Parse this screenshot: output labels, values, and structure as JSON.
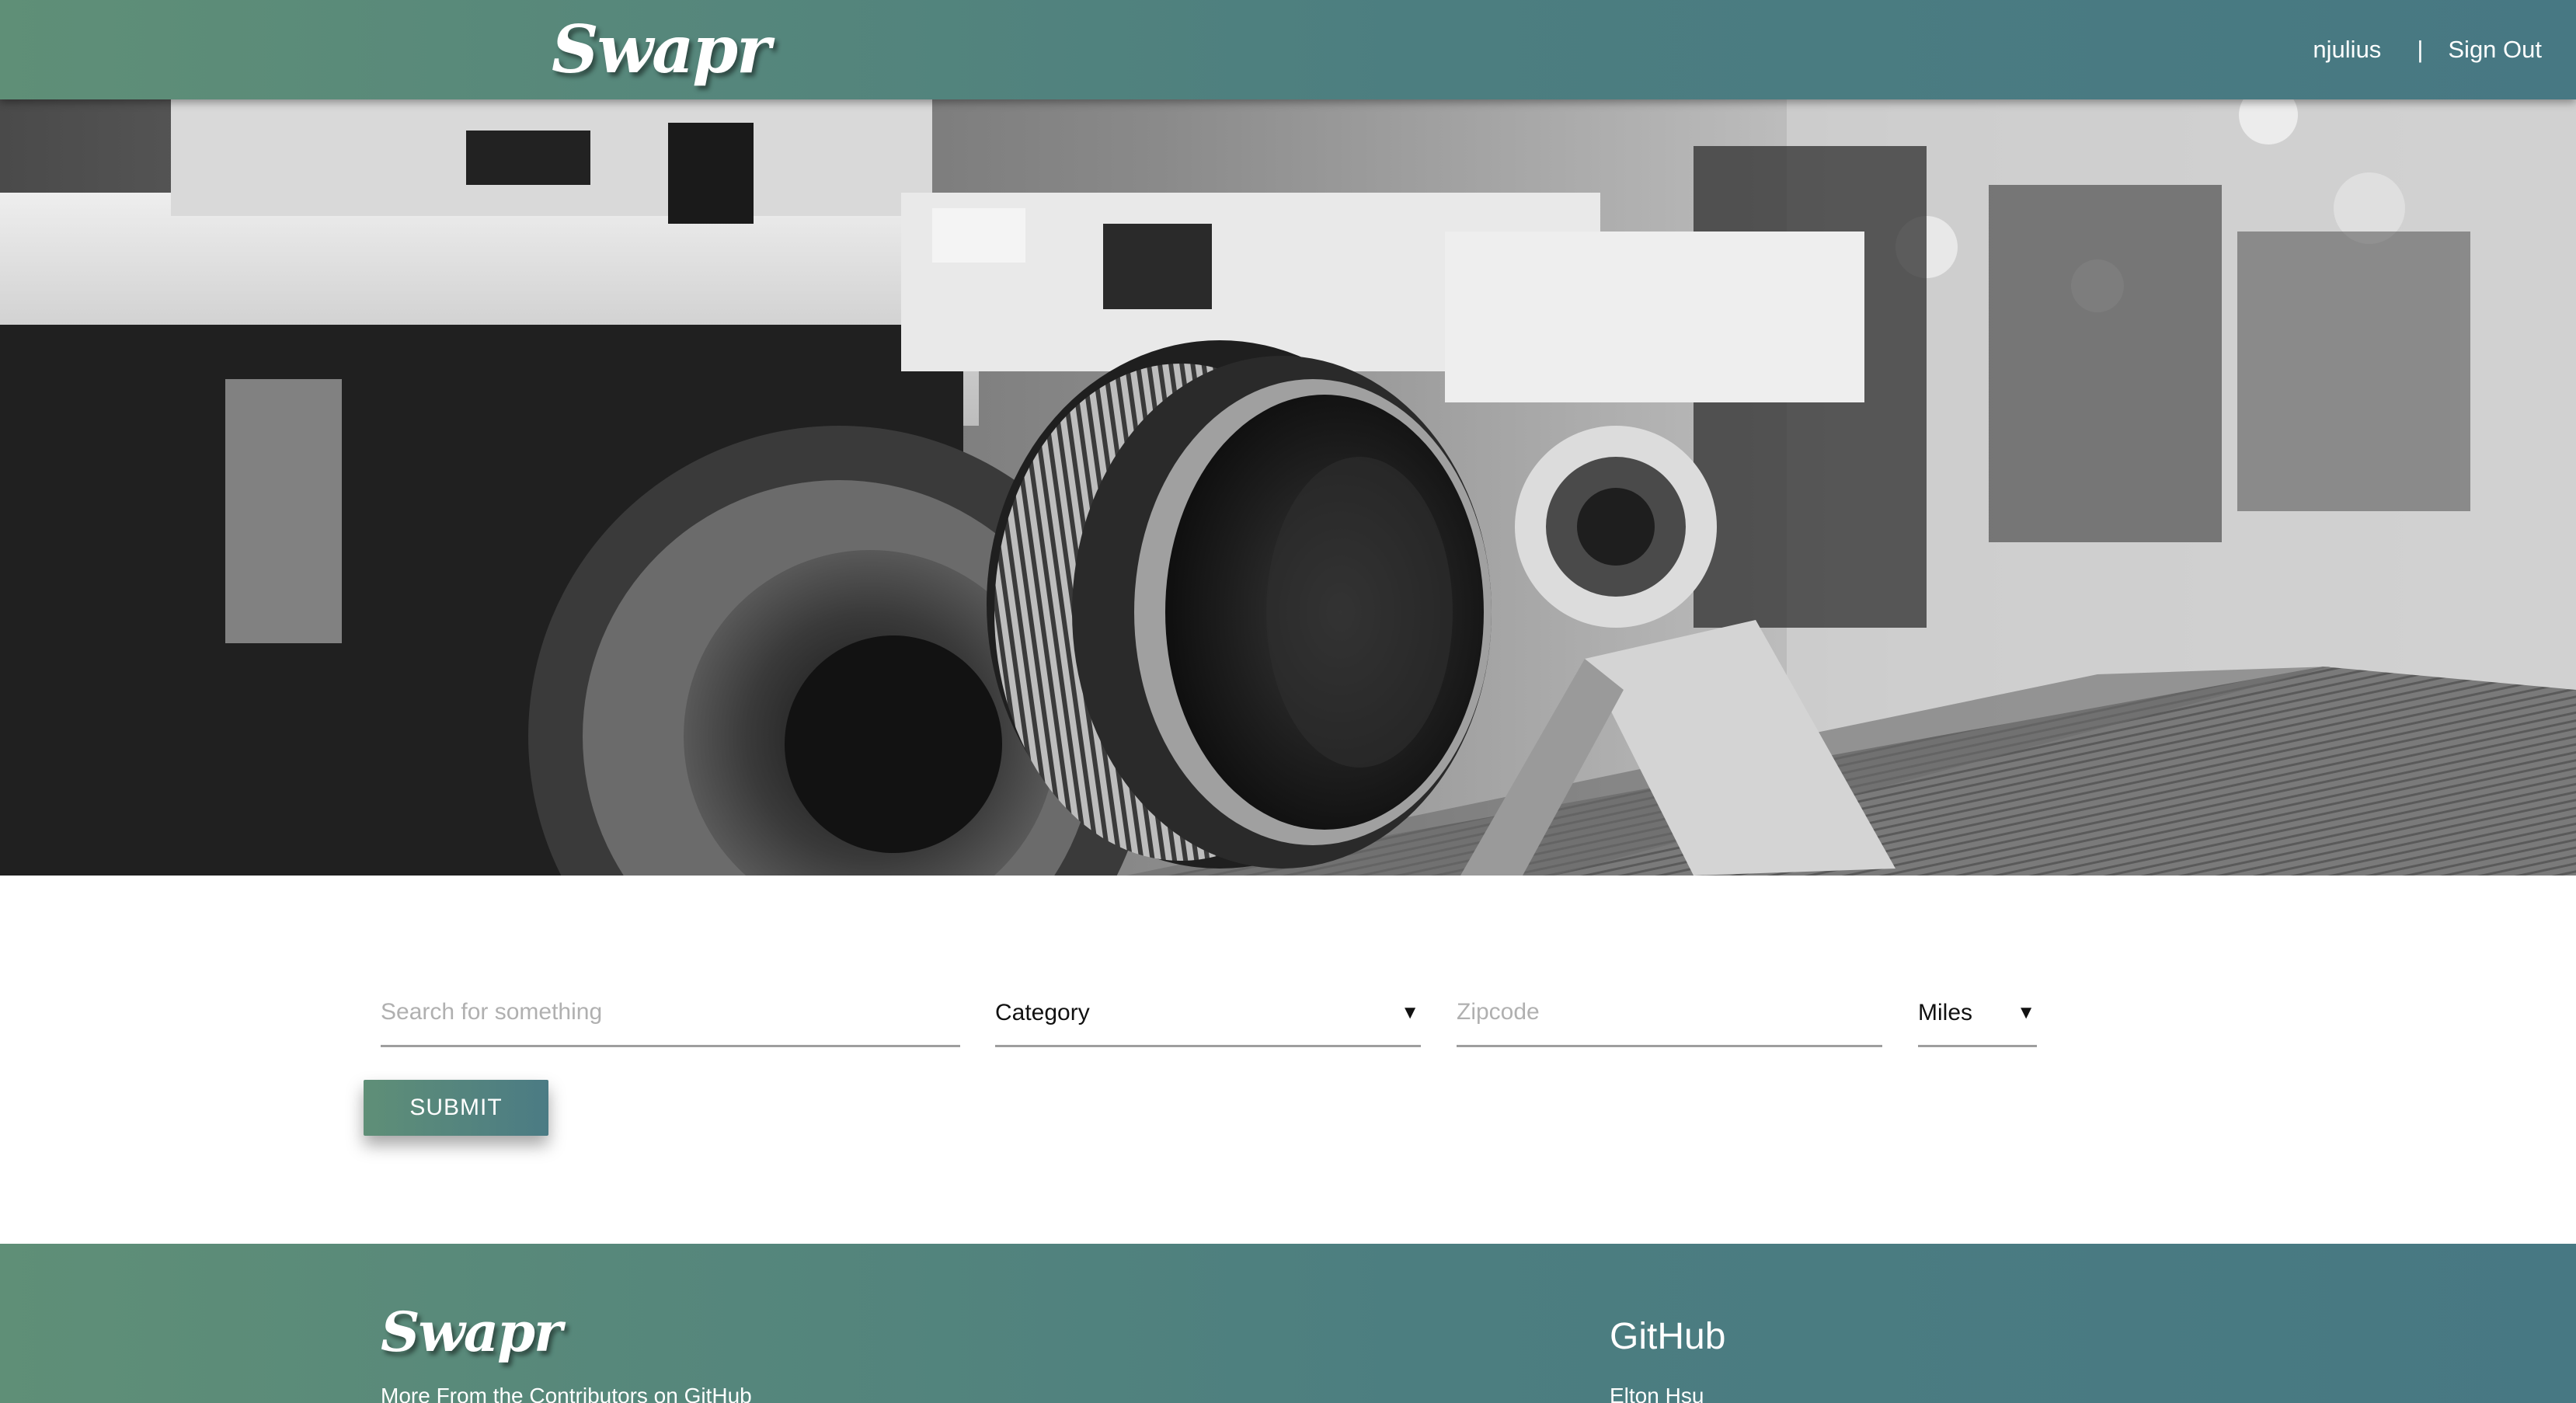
{
  "header": {
    "logo": "Swapr",
    "username": "njulius",
    "separator": "|",
    "sign_out": "Sign Out"
  },
  "hero": {
    "image": "camera-photo"
  },
  "search": {
    "query_placeholder": "Search for something",
    "category_value": "Category",
    "zipcode_placeholder": "Zipcode",
    "distance_value": "Miles",
    "submit_label": "SUBMIT"
  },
  "footer": {
    "logo": "Swapr",
    "tagline": "More From the Contributors on GitHub",
    "github_heading": "GitHub",
    "contributors": [
      "Elton Hsu"
    ]
  },
  "colors": {
    "brand_start": "#5f8f77",
    "brand_end": "#477883",
    "field_underline": "#9e9e9e",
    "placeholder": "#b0b0b0"
  },
  "icons": {
    "dropdown": "caret-down-icon"
  }
}
